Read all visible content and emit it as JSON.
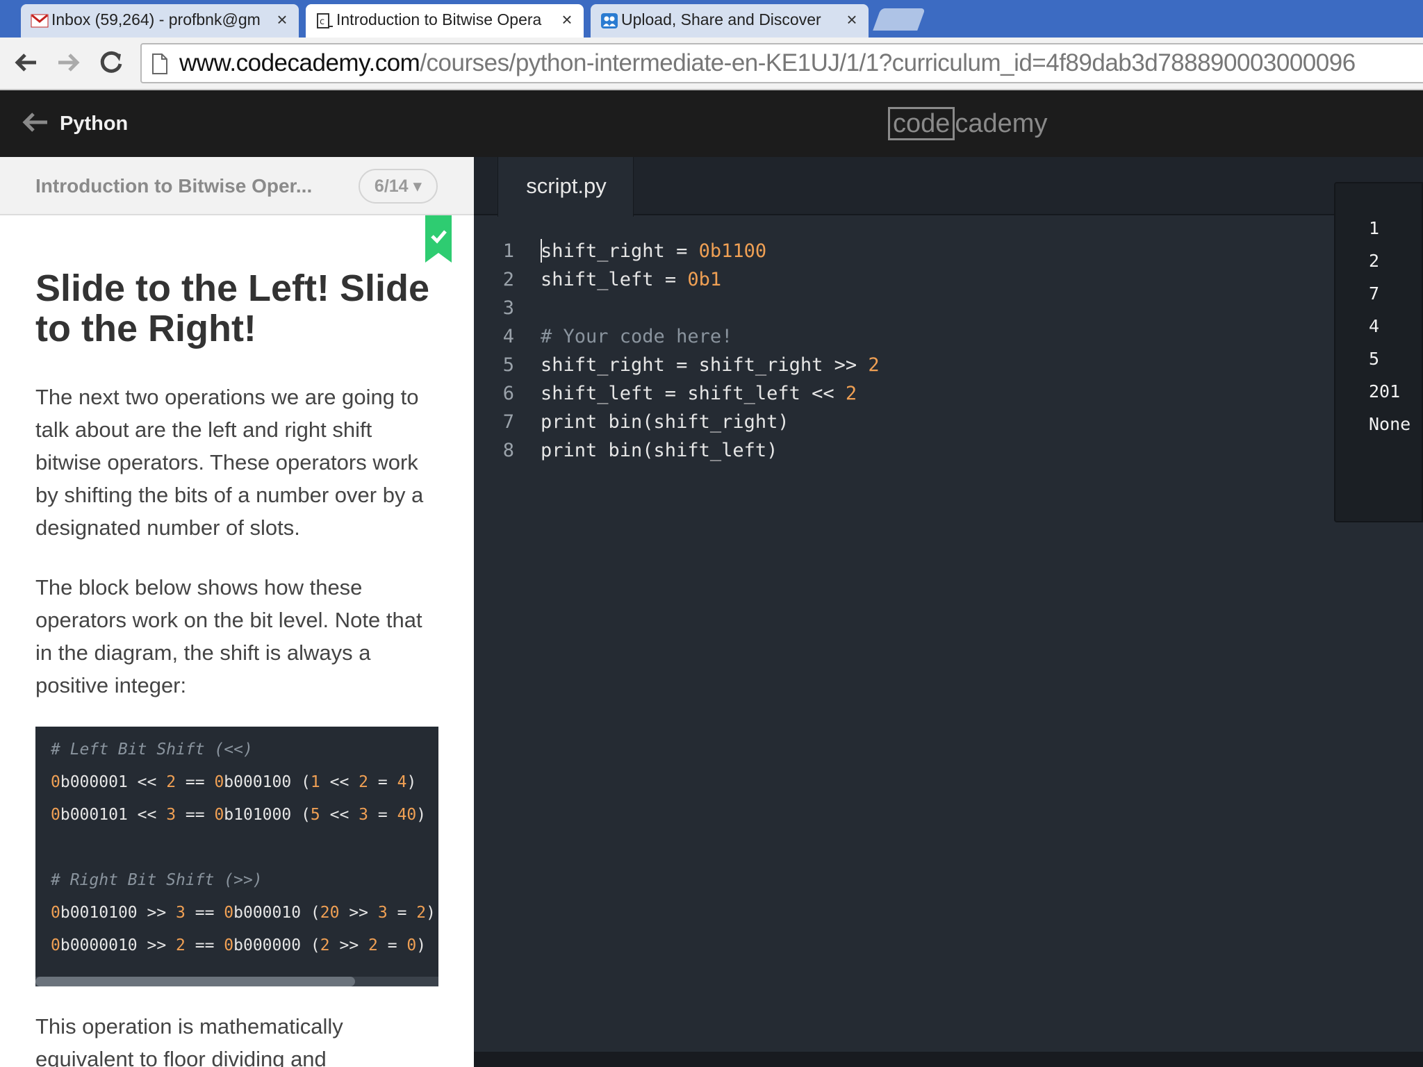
{
  "browser": {
    "tabs": [
      {
        "title": "Inbox (59,264) - profbnk@gm",
        "icon": "gmail-icon",
        "active": false
      },
      {
        "title": "Introduction to Bitwise Opera",
        "icon": "codecademy-icon",
        "active": true
      },
      {
        "title": "Upload, Share and Discover",
        "icon": "share-icon",
        "active": false
      }
    ],
    "close_glyph": "×",
    "url_host": "www.codecademy.com",
    "url_path": "/courses/python-intermediate-en-KE1UJ/1/1?curriculum_id=4f89dab3d788890003000096"
  },
  "header": {
    "course": "Python",
    "brand_code": "code",
    "brand_rest": "cademy"
  },
  "lesson": {
    "short_title": "Introduction to Bitwise Oper...",
    "progress": "6/14 ▾",
    "title": "Slide to the Left! Slide to the Right!",
    "para1": "The next two operations we are going to talk about are the left and right shift bitwise operators. These operators work by shifting the bits of a number over by a designated number of slots.",
    "para2": "The block below shows how these operators work on the bit level. Note that in the diagram, the shift is always a positive integer:",
    "para3": "This operation is mathematically equivalent to floor dividing and",
    "example": {
      "comment_left": "# Left Bit Shift (<<)",
      "comment_right": "# Right Bit Shift (>>)"
    }
  },
  "editor": {
    "filename": "script.py",
    "line_numbers": [
      "1",
      "2",
      "3",
      "4",
      "5",
      "6",
      "7",
      "8"
    ],
    "code": {
      "l1_var": "shift_right",
      "l1_op": " = ",
      "l1_num": "0b1100",
      "l2_var": "shift_left",
      "l2_op": " = ",
      "l2_num": "0b1",
      "l4": "# Your code here!",
      "l5_text": "shift_right = shift_right >> ",
      "l5_num": "2",
      "l6_text": "shift_left = shift_left << ",
      "l6_num": "2",
      "l7": "print bin(shift_right)",
      "l8": "print bin(shift_left)"
    }
  },
  "output": [
    "1",
    "2",
    "7",
    "4",
    "5",
    "201",
    "None"
  ],
  "colors": {
    "accent_green": "#2ecc71",
    "number_orange": "#f0a054",
    "editor_bg": "#252b33"
  }
}
